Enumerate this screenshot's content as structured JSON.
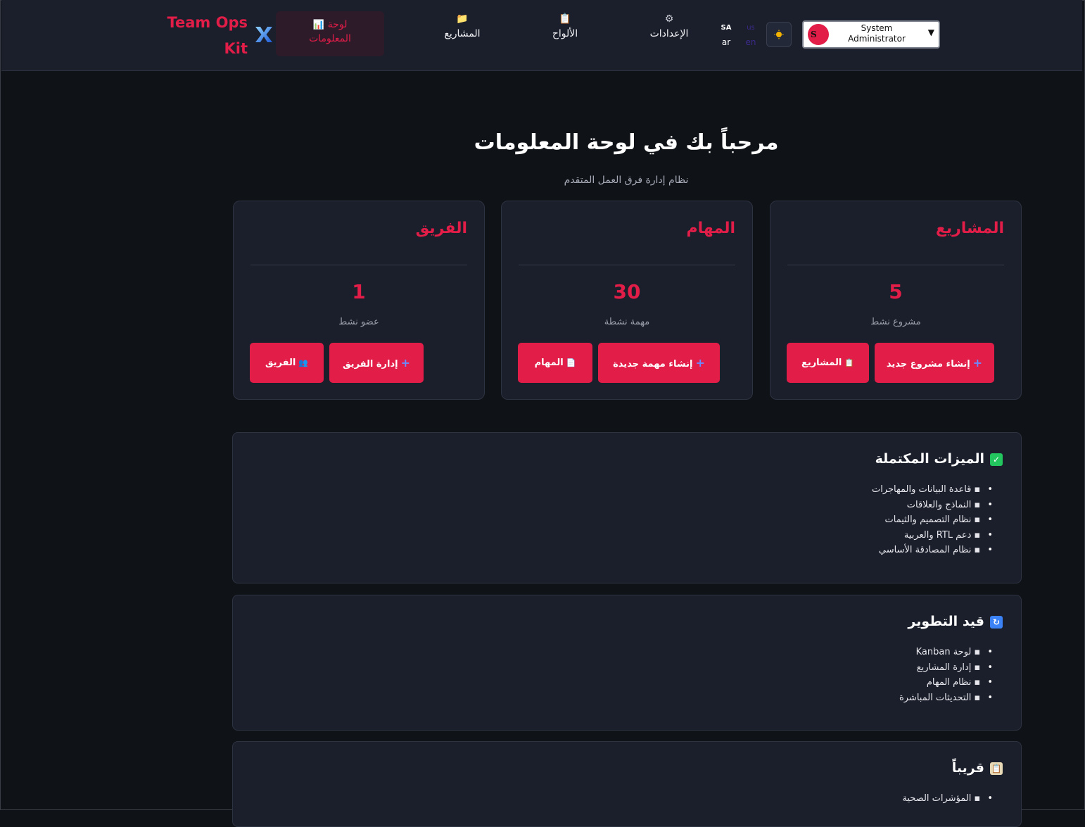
{
  "header": {
    "brand": {
      "line1": "Team Ops",
      "line2": "Kit",
      "icon": "x-logo-icon"
    },
    "nav": {
      "dashboard": {
        "icon": "📊",
        "label_line1": "لوحة",
        "label_line2": "المعلومات"
      },
      "projects": {
        "icon": "📁",
        "label": "المشاريع"
      },
      "boards": {
        "icon": "📋",
        "label": "الألواح"
      },
      "settings": {
        "icon": "⚙",
        "label": "الإعدادات"
      }
    },
    "languages": {
      "ar": {
        "code": "SA",
        "label": "ar"
      },
      "en": {
        "code": "us",
        "label": "en"
      }
    },
    "theme_icon": "sun-icon",
    "user": {
      "initial": "S",
      "name_line1": "System",
      "name_line2": "Administrator",
      "caret": "▼"
    }
  },
  "hero": {
    "title": "مرحباً بك في لوحة المعلومات",
    "subtitle": "نظام إدارة فرق العمل المتقدم"
  },
  "cards": {
    "projects": {
      "title": "المشاريع",
      "count": "5",
      "count_label": "مشروع نشط",
      "primary_btn": "إنشاء مشروع جديد",
      "secondary_btn": "المشاريع",
      "secondary_icon": "📋"
    },
    "tasks": {
      "title": "المهام",
      "count": "30",
      "count_label": "مهمة نشطة",
      "primary_btn": "إنشاء مهمة جديدة",
      "secondary_btn": "المهام",
      "secondary_icon": "📄"
    },
    "team": {
      "title": "الفريق",
      "count": "1",
      "count_label": "عضو نشط",
      "primary_btn": "إدارة الفريق",
      "secondary_btn": "الفريق",
      "secondary_icon": "👥"
    }
  },
  "panels": {
    "completed": {
      "badge": "✓",
      "title": "الميزات المكتملة",
      "items": [
        "▪ قاعدة البيانات والمهاجرات",
        "▪ النماذج والعلاقات",
        "▪ نظام التصميم والثيمات",
        "▪ دعم RTL والعربية",
        "▪ نظام المصادقة الأساسي"
      ]
    },
    "in_progress": {
      "badge": "↻",
      "title": "قيد التطوير",
      "items": [
        "▪ لوحة Kanban",
        "▪ إدارة المشاريع",
        "▪ نظام المهام",
        "▪ التحديثات المباشرة"
      ]
    },
    "soon": {
      "badge": "📋",
      "title": "قريباً",
      "items": [
        "▪ المؤشرات الصحية"
      ]
    }
  },
  "colors": {
    "accent": "#e11d48",
    "background": "#0f1217",
    "surface": "#1b1f2b"
  }
}
